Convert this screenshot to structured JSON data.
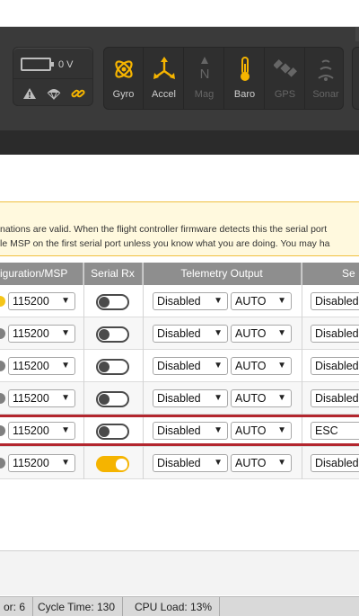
{
  "header": {
    "battery_voltage": "0 V",
    "sensors": [
      {
        "name": "Gyro",
        "active": true,
        "icon": "gyro-icon"
      },
      {
        "name": "Accel",
        "active": true,
        "icon": "accel-icon"
      },
      {
        "name": "Mag",
        "active": false,
        "icon": "mag-icon",
        "glyph": "N"
      },
      {
        "name": "Baro",
        "active": true,
        "icon": "baro-icon"
      },
      {
        "name": "GPS",
        "active": false,
        "icon": "gps-icon"
      },
      {
        "name": "Sonar",
        "active": false,
        "icon": "sonar-icon"
      }
    ]
  },
  "note": {
    "line1": "nations are valid. When the flight controller firmware detects this the serial port",
    "line2": "le MSP on the first serial port unless you know what you are doing. You may ha"
  },
  "table": {
    "headers": {
      "config": "iguration/MSP",
      "serial_rx": "Serial Rx",
      "telemetry": "Telemetry Output",
      "sensor": "Se"
    },
    "rows": [
      {
        "msp_baud": "115200",
        "serial_rx": false,
        "telemetry": "Disabled",
        "telemetry_baud": "AUTO",
        "sensor": "Disabled",
        "dot": "yellow"
      },
      {
        "msp_baud": "115200",
        "serial_rx": false,
        "telemetry": "Disabled",
        "telemetry_baud": "AUTO",
        "sensor": "Disabled",
        "dot": "gray"
      },
      {
        "msp_baud": "115200",
        "serial_rx": false,
        "telemetry": "Disabled",
        "telemetry_baud": "AUTO",
        "sensor": "Disabled",
        "dot": "gray"
      },
      {
        "msp_baud": "115200",
        "serial_rx": false,
        "telemetry": "Disabled",
        "telemetry_baud": "AUTO",
        "sensor": "Disabled",
        "dot": "gray"
      },
      {
        "msp_baud": "115200",
        "serial_rx": false,
        "telemetry": "Disabled",
        "telemetry_baud": "AUTO",
        "sensor": "ESC",
        "dot": "gray"
      },
      {
        "msp_baud": "115200",
        "serial_rx": true,
        "telemetry": "Disabled",
        "telemetry_baud": "AUTO",
        "sensor": "Disabled",
        "dot": "gray"
      }
    ]
  },
  "status": {
    "errors": "or: 6",
    "cycle_time": "Cycle Time: 130",
    "cpu_load": "CPU Load: 13%"
  },
  "colors": {
    "accent": "#f5b400",
    "highlight_line": "#b3262e",
    "header_bg": "#3a3a3a"
  }
}
